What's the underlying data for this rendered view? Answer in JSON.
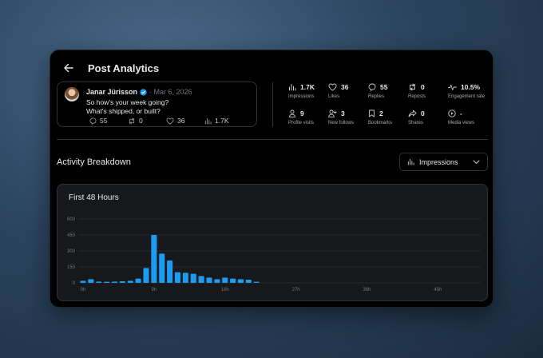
{
  "header": {
    "title": "Post Analytics"
  },
  "post": {
    "author": "Janar Jürisson",
    "date": "Mar 6, 2026",
    "text_line1": "So how's your week going?",
    "text_line2": "What's shipped, or built?",
    "stats": {
      "replies": "55",
      "reposts": "0",
      "likes": "36",
      "views": "1.7K"
    }
  },
  "metrics": [
    {
      "icon": "bar-chart-icon",
      "value": "1.7K",
      "label": "Impressions"
    },
    {
      "icon": "heart-icon",
      "value": "36",
      "label": "Likes"
    },
    {
      "icon": "reply-icon",
      "value": "55",
      "label": "Replies"
    },
    {
      "icon": "repost-icon",
      "value": "0",
      "label": "Reposts"
    },
    {
      "icon": "pulse-icon",
      "value": "10.5%",
      "label": "Engagement rate"
    },
    {
      "icon": "person-icon",
      "value": "9",
      "label": "Profile visits"
    },
    {
      "icon": "add-person-icon",
      "value": "3",
      "label": "New follows"
    },
    {
      "icon": "bookmark-icon",
      "value": "2",
      "label": "Bookmarks"
    },
    {
      "icon": "share-icon",
      "value": "0",
      "label": "Shares"
    },
    {
      "icon": "play-circle-icon",
      "value": "-",
      "label": "Media views"
    }
  ],
  "section": {
    "title": "Activity Breakdown"
  },
  "select": {
    "value": "Impressions"
  },
  "colors": {
    "accent": "#1d9bf0",
    "verified": "#1d9bf0"
  },
  "chart_data": {
    "type": "bar",
    "title": "First 48 Hours",
    "xlabel": "",
    "ylabel": "",
    "ylim": [
      0,
      600
    ],
    "xlim": [
      0,
      48
    ],
    "yticks": [
      0,
      150,
      300,
      450,
      600
    ],
    "xticks": [
      {
        "value": 0,
        "label": "0h"
      },
      {
        "value": 9,
        "label": "9h"
      },
      {
        "value": 18,
        "label": "18h"
      },
      {
        "value": 27,
        "label": "27h"
      },
      {
        "value": 36,
        "label": "36h"
      },
      {
        "value": 45,
        "label": "45h"
      }
    ],
    "grid": true,
    "categories": [
      0,
      1,
      2,
      3,
      4,
      5,
      6,
      7,
      8,
      9,
      10,
      11,
      12,
      13,
      14,
      15,
      16,
      17,
      18,
      19,
      20,
      21,
      22
    ],
    "values": [
      20,
      35,
      12,
      10,
      12,
      15,
      20,
      40,
      140,
      450,
      275,
      210,
      100,
      95,
      85,
      65,
      50,
      35,
      50,
      40,
      35,
      30,
      10
    ]
  }
}
